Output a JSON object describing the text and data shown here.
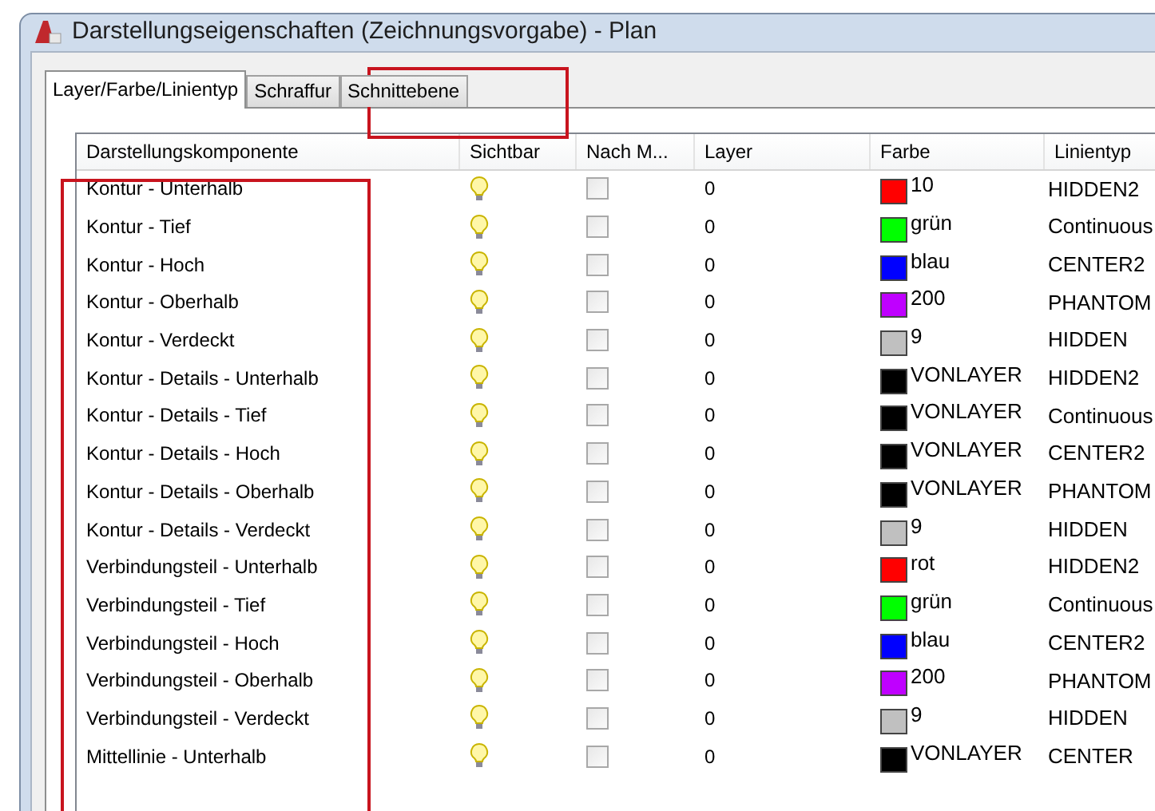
{
  "window": {
    "title": "Darstellungseigenschaften (Zeichnungsvorgabe) - Plan"
  },
  "tabs": [
    {
      "label": "Layer/Farbe/Linientyp",
      "selected": true
    },
    {
      "label": "Schraffur",
      "selected": false
    },
    {
      "label": "Schnittebene",
      "selected": false
    }
  ],
  "table": {
    "columns": [
      "Darstellungskomponente",
      "Sichtbar",
      "Nach M...",
      "Layer",
      "Farbe",
      "Linientyp"
    ],
    "rows": [
      {
        "name": "Kontur - Unterhalb",
        "visible": true,
        "checked": false,
        "layer": "0",
        "color": "#ff0000",
        "farbe": "10",
        "linetype": "HIDDEN2"
      },
      {
        "name": "Kontur - Tief",
        "visible": true,
        "checked": false,
        "layer": "0",
        "color": "#00ff00",
        "farbe": "grün",
        "linetype": "Continuous"
      },
      {
        "name": "Kontur - Hoch",
        "visible": true,
        "checked": false,
        "layer": "0",
        "color": "#0000ff",
        "farbe": "blau",
        "linetype": "CENTER2"
      },
      {
        "name": "Kontur - Oberhalb",
        "visible": true,
        "checked": false,
        "layer": "0",
        "color": "#bf00ff",
        "farbe": "200",
        "linetype": "PHANTOM"
      },
      {
        "name": "Kontur - Verdeckt",
        "visible": true,
        "checked": false,
        "layer": "0",
        "color": "#c0c0c0",
        "farbe": "9",
        "linetype": "HIDDEN"
      },
      {
        "name": "Kontur - Details - Unterhalb",
        "visible": true,
        "checked": false,
        "layer": "0",
        "color": "#000000",
        "farbe": "VONLAYER",
        "linetype": "HIDDEN2"
      },
      {
        "name": "Kontur - Details - Tief",
        "visible": true,
        "checked": false,
        "layer": "0",
        "color": "#000000",
        "farbe": "VONLAYER",
        "linetype": "Continuous"
      },
      {
        "name": "Kontur - Details - Hoch",
        "visible": true,
        "checked": false,
        "layer": "0",
        "color": "#000000",
        "farbe": "VONLAYER",
        "linetype": "CENTER2"
      },
      {
        "name": "Kontur - Details - Oberhalb",
        "visible": true,
        "checked": false,
        "layer": "0",
        "color": "#000000",
        "farbe": "VONLAYER",
        "linetype": "PHANTOM"
      },
      {
        "name": "Kontur - Details - Verdeckt",
        "visible": true,
        "checked": false,
        "layer": "0",
        "color": "#c0c0c0",
        "farbe": "9",
        "linetype": "HIDDEN"
      },
      {
        "name": "Verbindungsteil - Unterhalb",
        "visible": true,
        "checked": false,
        "layer": "0",
        "color": "#ff0000",
        "farbe": "rot",
        "linetype": "HIDDEN2"
      },
      {
        "name": "Verbindungsteil - Tief",
        "visible": true,
        "checked": false,
        "layer": "0",
        "color": "#00ff00",
        "farbe": "grün",
        "linetype": "Continuous"
      },
      {
        "name": "Verbindungsteil - Hoch",
        "visible": true,
        "checked": false,
        "layer": "0",
        "color": "#0000ff",
        "farbe": "blau",
        "linetype": "CENTER2"
      },
      {
        "name": "Verbindungsteil - Oberhalb",
        "visible": true,
        "checked": false,
        "layer": "0",
        "color": "#bf00ff",
        "farbe": "200",
        "linetype": "PHANTOM"
      },
      {
        "name": "Verbindungsteil - Verdeckt",
        "visible": true,
        "checked": false,
        "layer": "0",
        "color": "#c0c0c0",
        "farbe": "9",
        "linetype": "HIDDEN"
      },
      {
        "name": "Mittellinie - Unterhalb",
        "visible": true,
        "checked": false,
        "layer": "0",
        "color": "#000000",
        "farbe": "VONLAYER",
        "linetype": "CENTER"
      }
    ]
  }
}
